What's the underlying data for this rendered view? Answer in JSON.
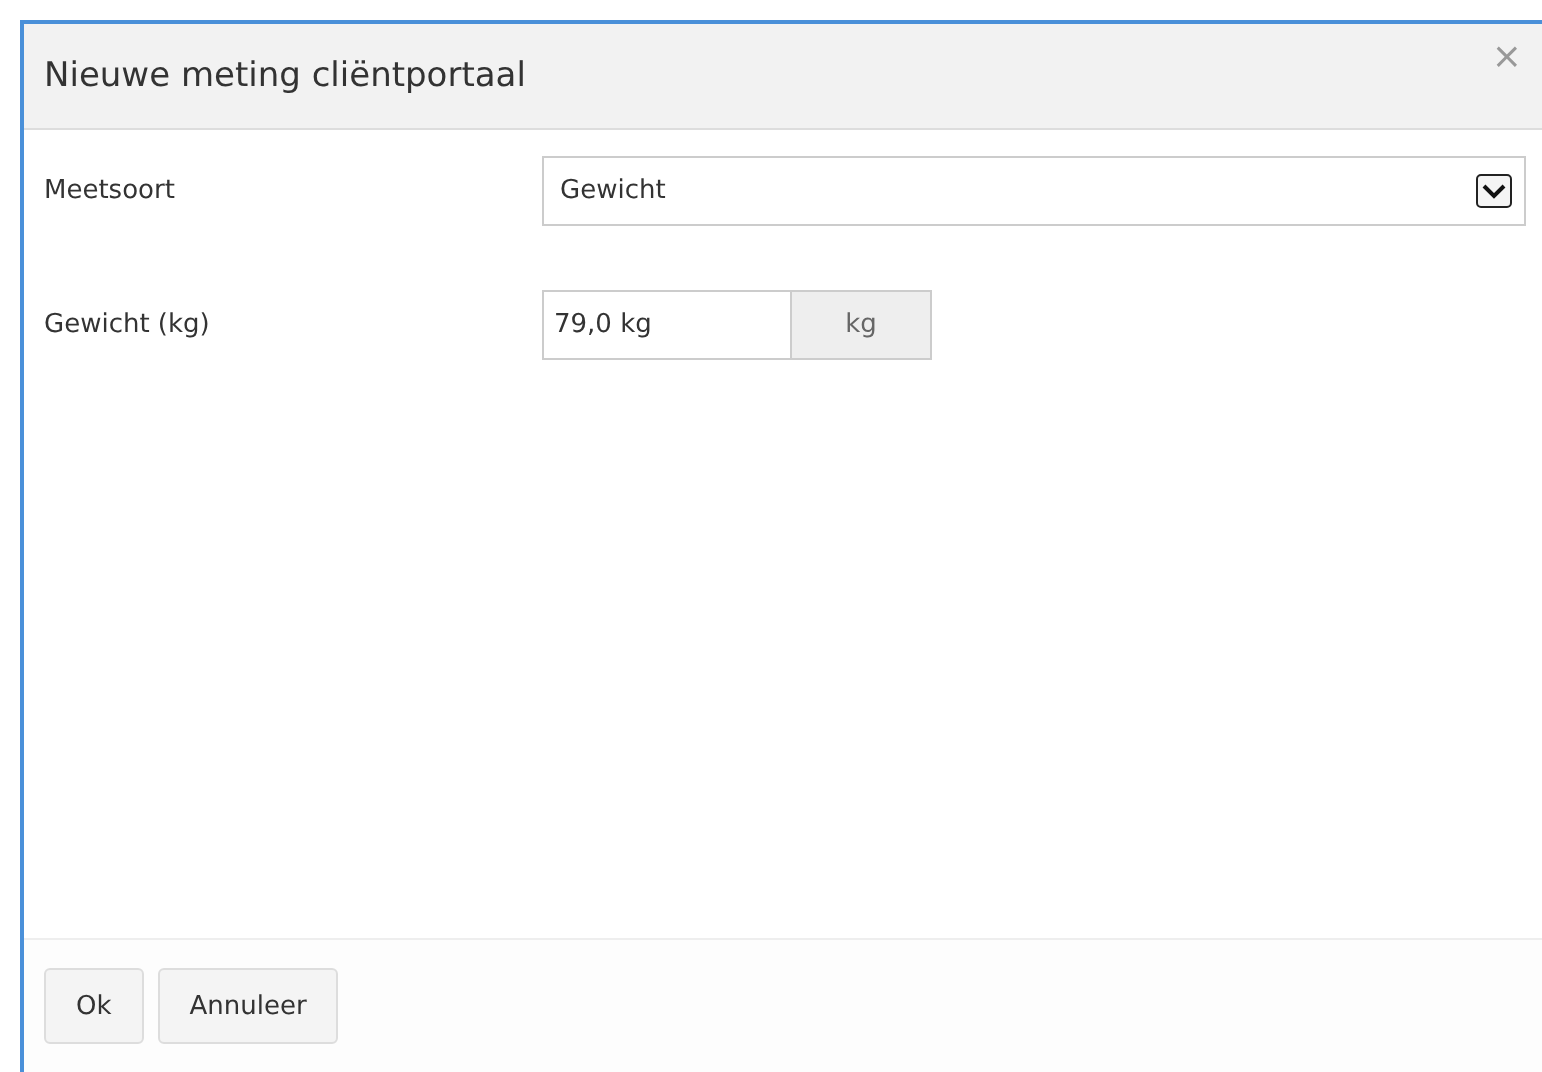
{
  "dialog": {
    "title": "Nieuwe meting cliëntportaal",
    "close": "×"
  },
  "fields": [
    {
      "kind": "select",
      "label": "Meetsoort",
      "value": "Gewicht"
    },
    {
      "kind": "unit",
      "label": "Gewicht (kg)",
      "value": "79,0 kg",
      "unit": "kg"
    }
  ],
  "buttons": [
    "Ok",
    "Annuleer"
  ]
}
